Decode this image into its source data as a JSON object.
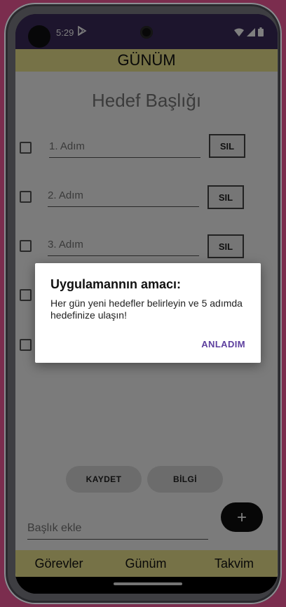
{
  "status_bar": {
    "time": "5:29",
    "icons": [
      "play-store-icon",
      "wifi-icon",
      "signal-icon",
      "battery-icon"
    ]
  },
  "app": {
    "title": "GÜNÜM",
    "goal_title_placeholder": "Hedef Başlığı",
    "steps": [
      {
        "placeholder": "1. Adım",
        "delete_label": "SIL"
      },
      {
        "placeholder": "2. Adım",
        "delete_label": "SIL"
      },
      {
        "placeholder": "3. Adım",
        "delete_label": "SIL"
      }
    ],
    "save_label": "KAYDET",
    "info_label": "BİLGİ",
    "title_input_placeholder": "Başlık ekle",
    "add_label": "+",
    "nav": [
      "Görevler",
      "Günüm",
      "Takvim"
    ],
    "accent_color": "#ece48e"
  },
  "dialog": {
    "title": "Uygulamannın amacı:",
    "message": "Her gün yeni hedefler belirleyin ve 5 adımda hedefinize ulaşın!",
    "button_label": "ANLADIM",
    "button_color": "#5d3f9e"
  }
}
